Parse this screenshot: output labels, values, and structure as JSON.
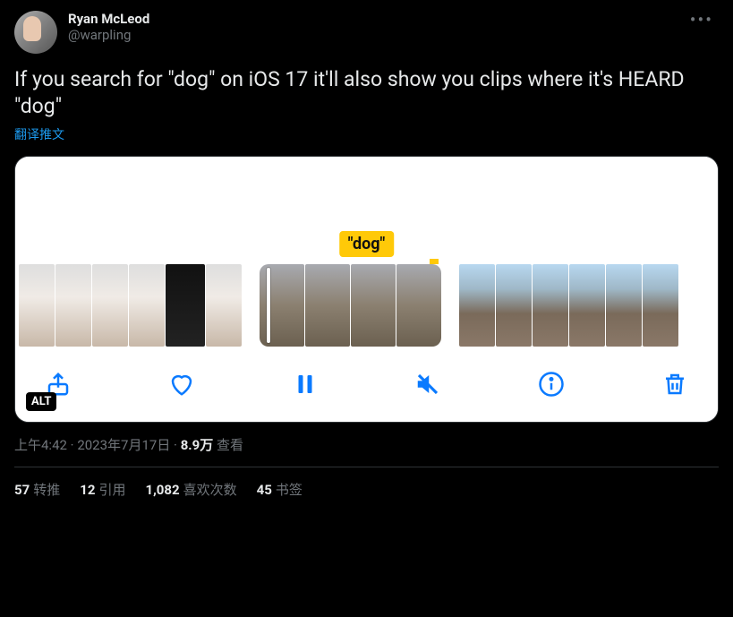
{
  "author": {
    "display_name": "Ryan McLeod",
    "handle": "@warpling"
  },
  "tweet_text": "If you search for \"dog\" on iOS 17 it'll also show you clips where it's HEARD \"dog\"",
  "translate_label": "翻译推文",
  "media": {
    "search_token": "\"dog\"",
    "alt_badge": "ALT"
  },
  "meta": {
    "time": "上午4:42",
    "date": "2023年7月17日",
    "views_number": "8.9万",
    "views_label": "查看",
    "separator": " · "
  },
  "stats": {
    "retweets_num": "57",
    "retweets_label": "转推",
    "quotes_num": "12",
    "quotes_label": "引用",
    "likes_num": "1,082",
    "likes_label": "喜欢次数",
    "bookmarks_num": "45",
    "bookmarks_label": "书签"
  }
}
